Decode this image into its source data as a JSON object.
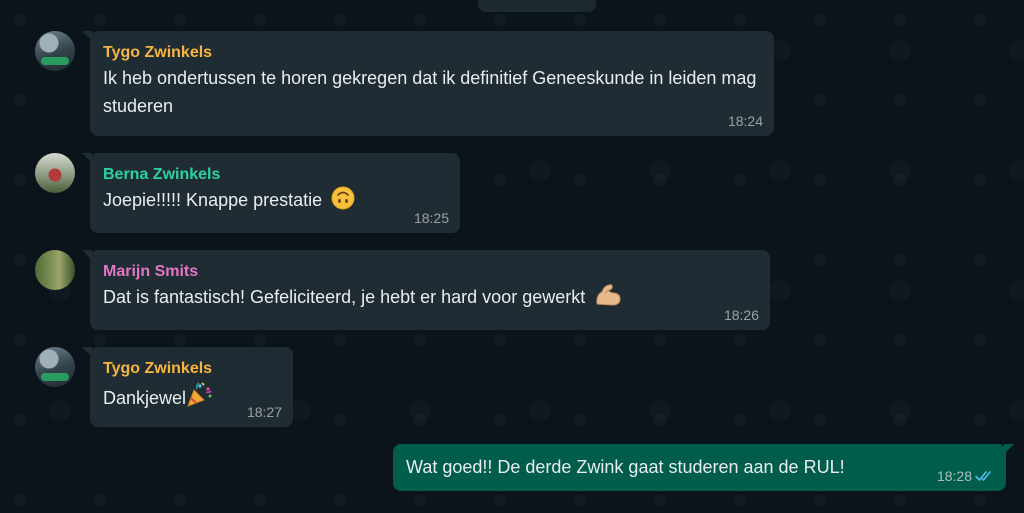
{
  "colors": {
    "background": "#0b141a",
    "incoming_bubble": "#202c33",
    "outgoing_bubble": "#005c4b",
    "sender_tygo": "#f7b440",
    "sender_berna": "#2bd1a3",
    "sender_marijn": "#e277c5",
    "read_ticks": "#53bdeb"
  },
  "messages": [
    {
      "sender": "Tygo Zwinkels",
      "text": "Ik heb ondertussen te horen gekregen dat ik definitief Geneeskunde in leiden mag studeren",
      "time": "18:24",
      "avatar": "tygo-avatar"
    },
    {
      "sender": "Berna Zwinkels",
      "text": "Joepie!!!!! Knappe prestatie",
      "emoji": "upside-down-face-emoji",
      "time": "18:25",
      "avatar": "berna-avatar"
    },
    {
      "sender": "Marijn Smits",
      "text": "Dat is fantastisch! Gefeliciteerd, je hebt er hard voor gewerkt",
      "emoji": "flexed-biceps-emoji",
      "time": "18:26",
      "avatar": "marijn-avatar"
    },
    {
      "sender": "Tygo Zwinkels",
      "text": "Dankjewel",
      "emoji": "party-popper-emoji",
      "time": "18:27",
      "avatar": "tygo-avatar"
    }
  ],
  "outgoing": {
    "text": "Wat goed!! De derde Zwink gaat studeren aan de RUL!",
    "time": "18:28",
    "status_icon": "double-check-read-icon"
  }
}
